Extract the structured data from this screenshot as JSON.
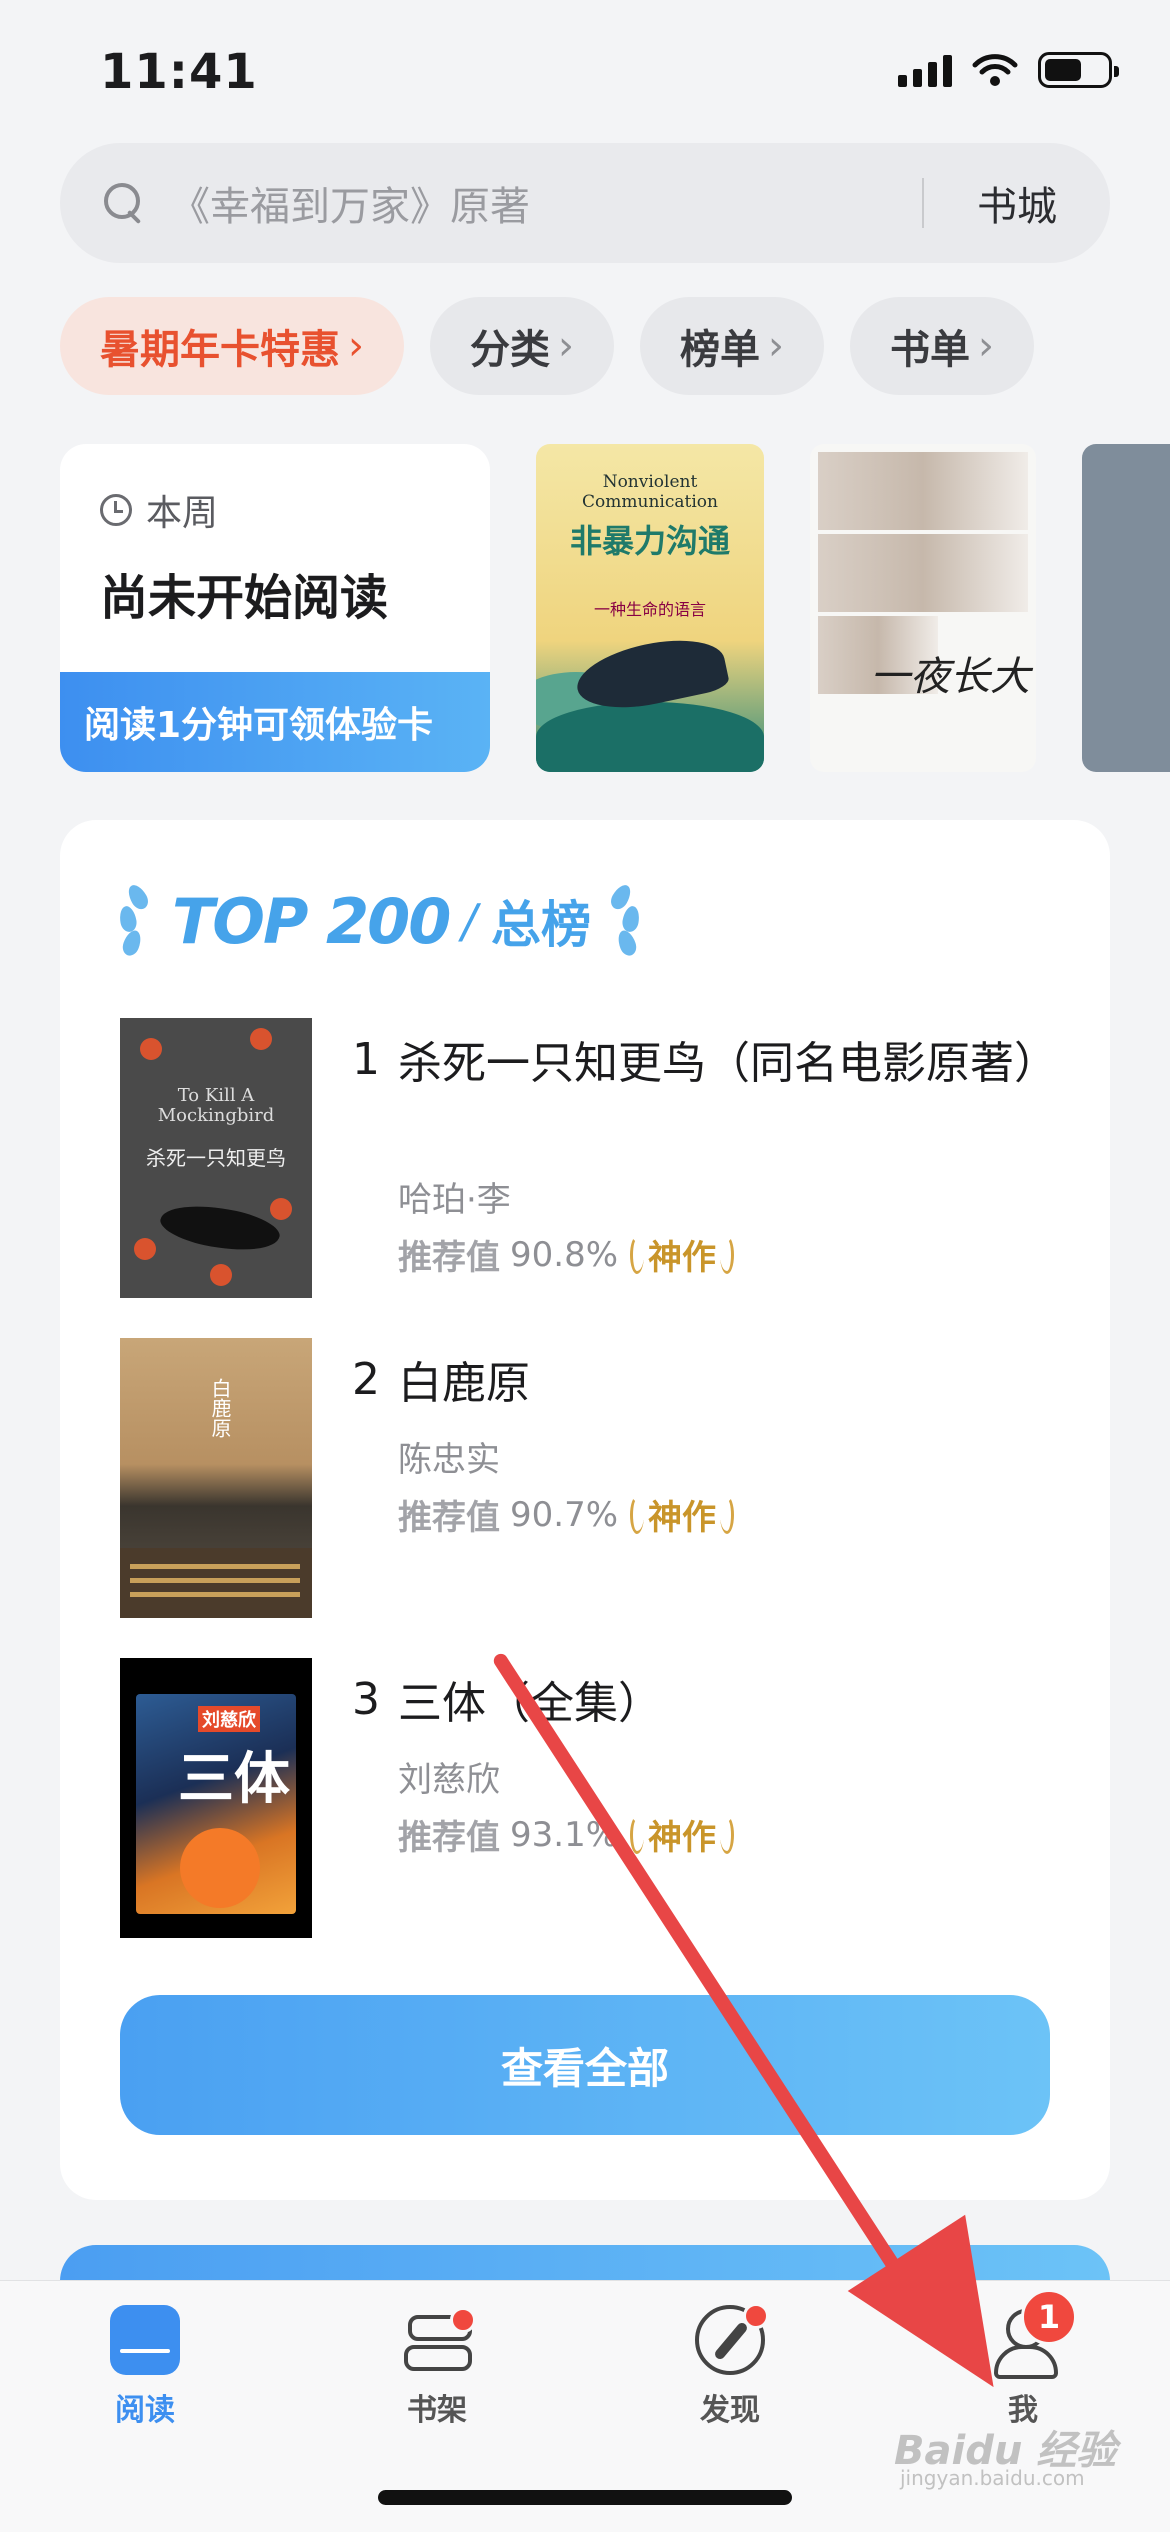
{
  "status_bar": {
    "time": "11:41"
  },
  "search": {
    "placeholder": "《幸福到万家》原著",
    "store_label": "书城"
  },
  "chips": [
    "暑期年卡特惠",
    "分类",
    "榜单",
    "书单"
  ],
  "reading_card": {
    "week_label": "本周",
    "status": "尚未开始阅读",
    "cta": "阅读1分钟可领体验卡"
  },
  "featured_covers": [
    {
      "title_en": "Nonviolent Communication",
      "title_cn": "非暴力沟通",
      "subtitle": "一种生命的语言"
    },
    {
      "title_cn": "一夜长大"
    }
  ],
  "top_list": {
    "logo_text": "TOP 200",
    "list_name": "总榜",
    "score_label": "推荐值",
    "badge_label": "神作",
    "books": [
      {
        "rank": "1",
        "title": "杀死一只知更鸟（同名电影原著）",
        "author": "哈珀·李",
        "score": "90.8%",
        "cover_en": "To Kill A Mockingbird",
        "cover_cn": "杀死一只知更鸟"
      },
      {
        "rank": "2",
        "title": "白鹿原",
        "author": "陈忠实",
        "score": "90.7%",
        "cover_cn": "白鹿原"
      },
      {
        "rank": "3",
        "title": "三体（全集）",
        "author": "刘慈欣",
        "score": "93.1%",
        "cover_author": "刘慈欣",
        "cover_cn": "三体"
      }
    ],
    "view_all": "查看全部"
  },
  "tabbar": {
    "tabs": [
      {
        "label": "阅读",
        "icon": "book-open-icon",
        "active": true
      },
      {
        "label": "书架",
        "icon": "bookshelf-icon",
        "dot": true
      },
      {
        "label": "发现",
        "icon": "compass-icon",
        "dot": true
      },
      {
        "label": "我",
        "icon": "profile-icon",
        "badge": "1"
      }
    ]
  },
  "overlay": {
    "annotation": "red-arrow-pointing-to-me-tab"
  },
  "watermark": {
    "text": "Baidu 经验",
    "sub": "jingyan.baidu.com"
  },
  "colors": {
    "accent": "#3d8ff0",
    "promo": "#e8512f",
    "badge": "#c9952a",
    "alert": "#f0483e"
  }
}
